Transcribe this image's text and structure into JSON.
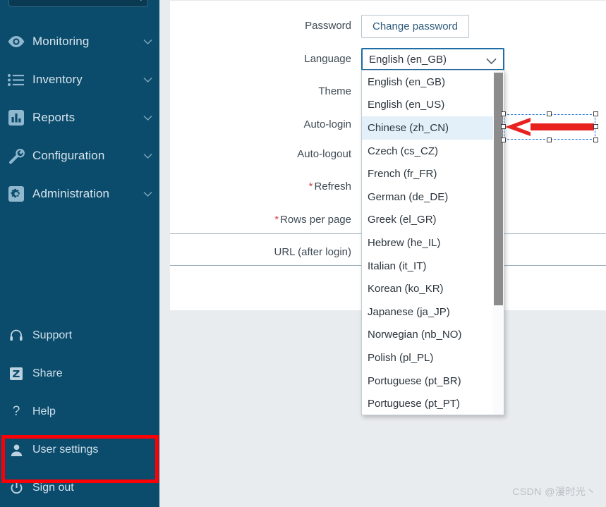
{
  "sidebar": {
    "search": {
      "placeholder": "",
      "value": "",
      "icon": "search-icon"
    },
    "nav": [
      {
        "label": "Monitoring",
        "icon": "eye-icon",
        "chevron": "chevron-down-icon"
      },
      {
        "label": "Inventory",
        "icon": "list-icon",
        "chevron": "chevron-down-icon"
      },
      {
        "label": "Reports",
        "icon": "bar-chart-icon",
        "chevron": "chevron-down-icon"
      },
      {
        "label": "Configuration",
        "icon": "wrench-icon",
        "chevron": "chevron-down-icon"
      },
      {
        "label": "Administration",
        "icon": "gear-icon",
        "chevron": "chevron-down-icon"
      }
    ],
    "utility": [
      {
        "label": "Support",
        "icon": "headset-icon"
      },
      {
        "label": "Share",
        "icon": "zabbix-z-icon"
      },
      {
        "label": "Help",
        "icon": "question-mark-icon"
      },
      {
        "label": "User settings",
        "icon": "user-icon"
      },
      {
        "label": "Sign out",
        "icon": "power-icon"
      }
    ],
    "highlight_color": "#fb0007",
    "background_color": "#0b4b6b"
  },
  "form": {
    "rows": [
      {
        "label": "Password",
        "required": false,
        "field": "button"
      },
      {
        "label": "Language",
        "required": false,
        "field": "select"
      },
      {
        "label": "Theme",
        "required": false,
        "field": "hidden"
      },
      {
        "label": "Auto-login",
        "required": false,
        "field": "hidden"
      },
      {
        "label": "Auto-logout",
        "required": false,
        "field": "hidden"
      },
      {
        "label": "Refresh",
        "required": true,
        "field": "hidden"
      },
      {
        "label": "Rows per page",
        "required": true,
        "field": "hidden"
      },
      {
        "label": "URL (after login)",
        "required": false,
        "field": "hidden"
      }
    ],
    "change_password_label": "Change password",
    "required_marker": "*"
  },
  "language_select": {
    "value": "English (en_GB)",
    "chevron": "chevron-down-icon",
    "open": true,
    "options": [
      "English (en_GB)",
      "English (en_US)",
      "Chinese (zh_CN)",
      "Czech (cs_CZ)",
      "French (fr_FR)",
      "German (de_DE)",
      "Greek (el_GR)",
      "Hebrew (he_IL)",
      "Italian (it_IT)",
      "Korean (ko_KR)",
      "Japanese (ja_JP)",
      "Norwegian (nb_NO)",
      "Polish (pl_PL)",
      "Portuguese (pt_BR)",
      "Portuguese (pt_PT)"
    ],
    "highlighted_option": "Chinese (zh_CN)",
    "highlight_background": "#e4f0f9"
  },
  "annotation": {
    "type": "arrow",
    "direction": "left",
    "color": "#e8221f",
    "selected": true,
    "handle_count": 8
  },
  "watermark": {
    "text": "CSDN @漫时光丶"
  }
}
